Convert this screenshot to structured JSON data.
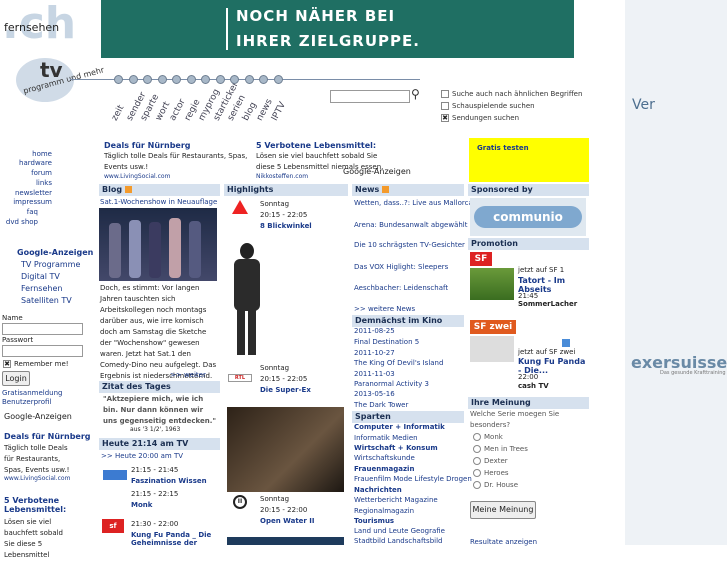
{
  "brand": {
    "ch": ".ch",
    "fernsehen": "fernsehen",
    "tv": "tv",
    "programm": "programm und mehr"
  },
  "nav_words": [
    "zeit",
    "sender",
    "sparte",
    "wort",
    "actor",
    "regie",
    "myprog",
    "starticker",
    "serien",
    "blog",
    "news",
    "IPTV"
  ],
  "banner": {
    "line1": "NOCH NÄHER BEI",
    "line2": "IHRER ZIELGRUPPE."
  },
  "search": {
    "options": [
      "Suche auch nach ähnlichen Begriffen",
      "Schauspielende suchen",
      "Sendungen suchen"
    ]
  },
  "right_panel": {
    "ver": "Ver",
    "exersuisse": "exersuisse",
    "exersuisse_sub": "Das gesunde Krafttraining"
  },
  "left_nav": [
    "home",
    "hardware",
    "forum",
    "links",
    "newsletter",
    "impressum",
    "faq",
    "dvd shop"
  ],
  "google_ads": {
    "title": "Google-Anzeigen",
    "links": [
      "TV Programme",
      "Digital TV",
      "Fernsehen",
      "Satelliten TV"
    ]
  },
  "login": {
    "name_label": "Name",
    "password_label": "Passwort",
    "remember": "Remember me!",
    "button": "Login",
    "register": "Gratisanmeldung",
    "profile": "Benutzerprofil"
  },
  "google_small": "Google-Anzeigen",
  "left_ads": [
    {
      "title": "Deals für Nürnberg",
      "body": "Täglich tolle Deals für Restaurants, Spas, Events usw.!",
      "url": "www.LivingSocial.com"
    },
    {
      "title": "5 Verbotene Lebensmittel:",
      "body": "Lösen sie viel bauchfett sobald Sie diese 5 Lebensmittel"
    }
  ],
  "top_ads": [
    {
      "title": "Deals für Nürnberg",
      "body": "Täglich tolle Deals für Restaurants, Spas, Events usw.!",
      "url": "www.LivingSocial.com"
    },
    {
      "title": "5 Verbotene Lebensmittel:",
      "body": "Lösen sie viel bauchfett sobald Sie diese 5 Lebensmittel niemals essen.",
      "url": "Nikkosteffen.com"
    }
  ],
  "google_center": "Google-Anzeigen",
  "gratis": "Gratis testen",
  "blog": {
    "header": "Blog",
    "title": "Sat.1-Wochenshow in Neuauflage",
    "text": "Doch, es stimmt: Vor langen Jahren tauschten sich Arbeitskollegen noch montags darüber aus, wie irre komisch doch am Samstag die Sketche der \"Wochenshow\" gewesen waren. Jetzt hat Sat.1 den Comedy-Dino neu aufgelegt. Das Ergebnis ist niederschmetternd.",
    "more": ">> weiter"
  },
  "quote": {
    "header": "Zitat des Tages",
    "text": "\"Aktzepiere mich, wie ich bin. Nur dann können wir uns gegenseitig entdecken.\"",
    "source": "aus '3 1/2', 1963"
  },
  "today": {
    "header": "Heute 21:14 am TV",
    "link": ">> Heute 20:00 am TV",
    "items": [
      {
        "time": "21:15 - 21:45",
        "title": "Faszination Wissen"
      },
      {
        "time": "21:15 - 22:15",
        "title": "Monk"
      },
      {
        "time": "21:30 - 22:00",
        "title": "Kung Fu Panda _ Die Geheimnisse der"
      }
    ]
  },
  "highlights": {
    "header": "Highlights",
    "items": [
      {
        "day": "Sonntag",
        "time": "20:15 - 22:05",
        "title": "8 Blickwinkel"
      },
      {
        "day": "Sonntag",
        "time": "20:15 - 22:05",
        "title": "Die Super-Ex"
      },
      {
        "day": "Sonntag",
        "time": "20:15 - 22:00",
        "title": "Open Water II"
      }
    ]
  },
  "news": {
    "header": "News",
    "items": [
      "Wetten, dass..?: Live aus Mallorca",
      "Arena: Bundesanwalt abgewählt",
      "Die 10 schrägsten TV-Gesichter",
      "Das VOX Higlight: Sleepers",
      "Aeschbacher: Leidenschaft"
    ],
    "more": ">> weitere News"
  },
  "cinema": {
    "header": "Demnächst im Kino",
    "items": [
      {
        "date": "2011-08-25",
        "title": "Final Destination 5"
      },
      {
        "date": "2011-10-27",
        "title": "The King Of Devil's Island"
      },
      {
        "date": "2011-11-03",
        "title": "Paranormal Activity 3"
      },
      {
        "date": "2013-05-16",
        "title": "The Dark Tower"
      }
    ]
  },
  "sparten": {
    "header": "Sparten",
    "items": [
      {
        "bold": "Computer + Informatik",
        "sub": "Informatik Medien"
      },
      {
        "bold": "Wirtschaft + Konsum",
        "sub": "Wirtschaftskunde"
      },
      {
        "bold": "Frauenmagazin",
        "sub": "Frauenfilm Mode Lifestyle Drogen"
      },
      {
        "bold": "Nachrichten",
        "sub": "Wetterbericht Magazine"
      },
      {
        "bold": "Regionalmagazin",
        "sub": ""
      },
      {
        "bold": "Tourismus",
        "sub": "Land und Leute Geografie"
      },
      {
        "bold": "",
        "sub": "Stadtbild Landschaftsbild"
      }
    ]
  },
  "sponsored": {
    "header": "Sponsored by",
    "name": "communio"
  },
  "promotion": {
    "header": "Promotion",
    "items": [
      {
        "channel": "SF 1",
        "label": "jetzt auf SF 1",
        "title": "Tatort - Im Abseits",
        "time": "21:45",
        "next": "SommerLacher"
      },
      {
        "channel": "SF zwei",
        "label": "jetzt auf SF zwei",
        "title": "Kung Fu Panda - Die...",
        "time": "22:00",
        "next": "cash TV"
      }
    ]
  },
  "poll": {
    "header": "Ihre Meinung",
    "question": "Welche Serie moegen Sie besonders?",
    "options": [
      "Monk",
      "Men in Trees",
      "Dexter",
      "Heroes",
      "Dr. House"
    ],
    "button": "Meine Meinung",
    "results": "Resultate anzeigen"
  },
  "colors": {
    "accent": "#1a3a8a",
    "header_bg": "#d6e1ee",
    "banner": "#1f6f63",
    "yellow": "#ffff00"
  }
}
